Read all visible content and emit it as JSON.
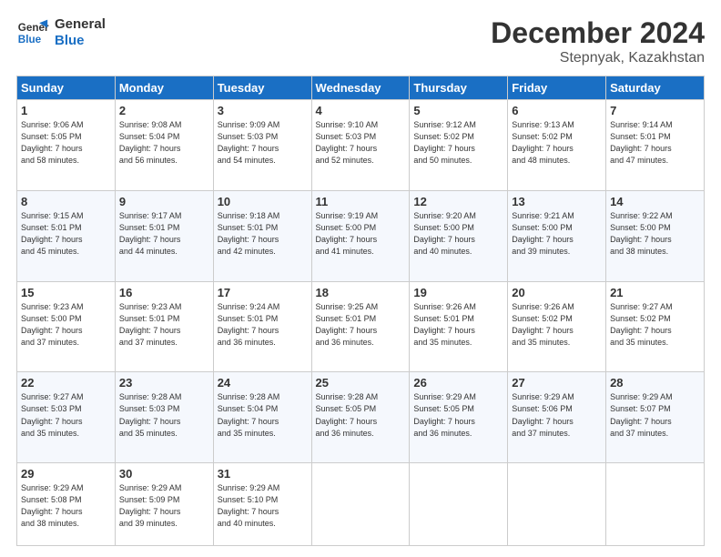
{
  "logo": {
    "line1": "General",
    "line2": "Blue"
  },
  "title": "December 2024",
  "subtitle": "Stepnyak, Kazakhstan",
  "days_header": [
    "Sunday",
    "Monday",
    "Tuesday",
    "Wednesday",
    "Thursday",
    "Friday",
    "Saturday"
  ],
  "weeks": [
    [
      {
        "num": "1",
        "info": "Sunrise: 9:06 AM\nSunset: 5:05 PM\nDaylight: 7 hours\nand 58 minutes."
      },
      {
        "num": "2",
        "info": "Sunrise: 9:08 AM\nSunset: 5:04 PM\nDaylight: 7 hours\nand 56 minutes."
      },
      {
        "num": "3",
        "info": "Sunrise: 9:09 AM\nSunset: 5:03 PM\nDaylight: 7 hours\nand 54 minutes."
      },
      {
        "num": "4",
        "info": "Sunrise: 9:10 AM\nSunset: 5:03 PM\nDaylight: 7 hours\nand 52 minutes."
      },
      {
        "num": "5",
        "info": "Sunrise: 9:12 AM\nSunset: 5:02 PM\nDaylight: 7 hours\nand 50 minutes."
      },
      {
        "num": "6",
        "info": "Sunrise: 9:13 AM\nSunset: 5:02 PM\nDaylight: 7 hours\nand 48 minutes."
      },
      {
        "num": "7",
        "info": "Sunrise: 9:14 AM\nSunset: 5:01 PM\nDaylight: 7 hours\nand 47 minutes."
      }
    ],
    [
      {
        "num": "8",
        "info": "Sunrise: 9:15 AM\nSunset: 5:01 PM\nDaylight: 7 hours\nand 45 minutes."
      },
      {
        "num": "9",
        "info": "Sunrise: 9:17 AM\nSunset: 5:01 PM\nDaylight: 7 hours\nand 44 minutes."
      },
      {
        "num": "10",
        "info": "Sunrise: 9:18 AM\nSunset: 5:01 PM\nDaylight: 7 hours\nand 42 minutes."
      },
      {
        "num": "11",
        "info": "Sunrise: 9:19 AM\nSunset: 5:00 PM\nDaylight: 7 hours\nand 41 minutes."
      },
      {
        "num": "12",
        "info": "Sunrise: 9:20 AM\nSunset: 5:00 PM\nDaylight: 7 hours\nand 40 minutes."
      },
      {
        "num": "13",
        "info": "Sunrise: 9:21 AM\nSunset: 5:00 PM\nDaylight: 7 hours\nand 39 minutes."
      },
      {
        "num": "14",
        "info": "Sunrise: 9:22 AM\nSunset: 5:00 PM\nDaylight: 7 hours\nand 38 minutes."
      }
    ],
    [
      {
        "num": "15",
        "info": "Sunrise: 9:23 AM\nSunset: 5:00 PM\nDaylight: 7 hours\nand 37 minutes."
      },
      {
        "num": "16",
        "info": "Sunrise: 9:23 AM\nSunset: 5:01 PM\nDaylight: 7 hours\nand 37 minutes."
      },
      {
        "num": "17",
        "info": "Sunrise: 9:24 AM\nSunset: 5:01 PM\nDaylight: 7 hours\nand 36 minutes."
      },
      {
        "num": "18",
        "info": "Sunrise: 9:25 AM\nSunset: 5:01 PM\nDaylight: 7 hours\nand 36 minutes."
      },
      {
        "num": "19",
        "info": "Sunrise: 9:26 AM\nSunset: 5:01 PM\nDaylight: 7 hours\nand 35 minutes."
      },
      {
        "num": "20",
        "info": "Sunrise: 9:26 AM\nSunset: 5:02 PM\nDaylight: 7 hours\nand 35 minutes."
      },
      {
        "num": "21",
        "info": "Sunrise: 9:27 AM\nSunset: 5:02 PM\nDaylight: 7 hours\nand 35 minutes."
      }
    ],
    [
      {
        "num": "22",
        "info": "Sunrise: 9:27 AM\nSunset: 5:03 PM\nDaylight: 7 hours\nand 35 minutes."
      },
      {
        "num": "23",
        "info": "Sunrise: 9:28 AM\nSunset: 5:03 PM\nDaylight: 7 hours\nand 35 minutes."
      },
      {
        "num": "24",
        "info": "Sunrise: 9:28 AM\nSunset: 5:04 PM\nDaylight: 7 hours\nand 35 minutes."
      },
      {
        "num": "25",
        "info": "Sunrise: 9:28 AM\nSunset: 5:05 PM\nDaylight: 7 hours\nand 36 minutes."
      },
      {
        "num": "26",
        "info": "Sunrise: 9:29 AM\nSunset: 5:05 PM\nDaylight: 7 hours\nand 36 minutes."
      },
      {
        "num": "27",
        "info": "Sunrise: 9:29 AM\nSunset: 5:06 PM\nDaylight: 7 hours\nand 37 minutes."
      },
      {
        "num": "28",
        "info": "Sunrise: 9:29 AM\nSunset: 5:07 PM\nDaylight: 7 hours\nand 37 minutes."
      }
    ],
    [
      {
        "num": "29",
        "info": "Sunrise: 9:29 AM\nSunset: 5:08 PM\nDaylight: 7 hours\nand 38 minutes."
      },
      {
        "num": "30",
        "info": "Sunrise: 9:29 AM\nSunset: 5:09 PM\nDaylight: 7 hours\nand 39 minutes."
      },
      {
        "num": "31",
        "info": "Sunrise: 9:29 AM\nSunset: 5:10 PM\nDaylight: 7 hours\nand 40 minutes."
      },
      {
        "num": "",
        "info": ""
      },
      {
        "num": "",
        "info": ""
      },
      {
        "num": "",
        "info": ""
      },
      {
        "num": "",
        "info": ""
      }
    ]
  ]
}
